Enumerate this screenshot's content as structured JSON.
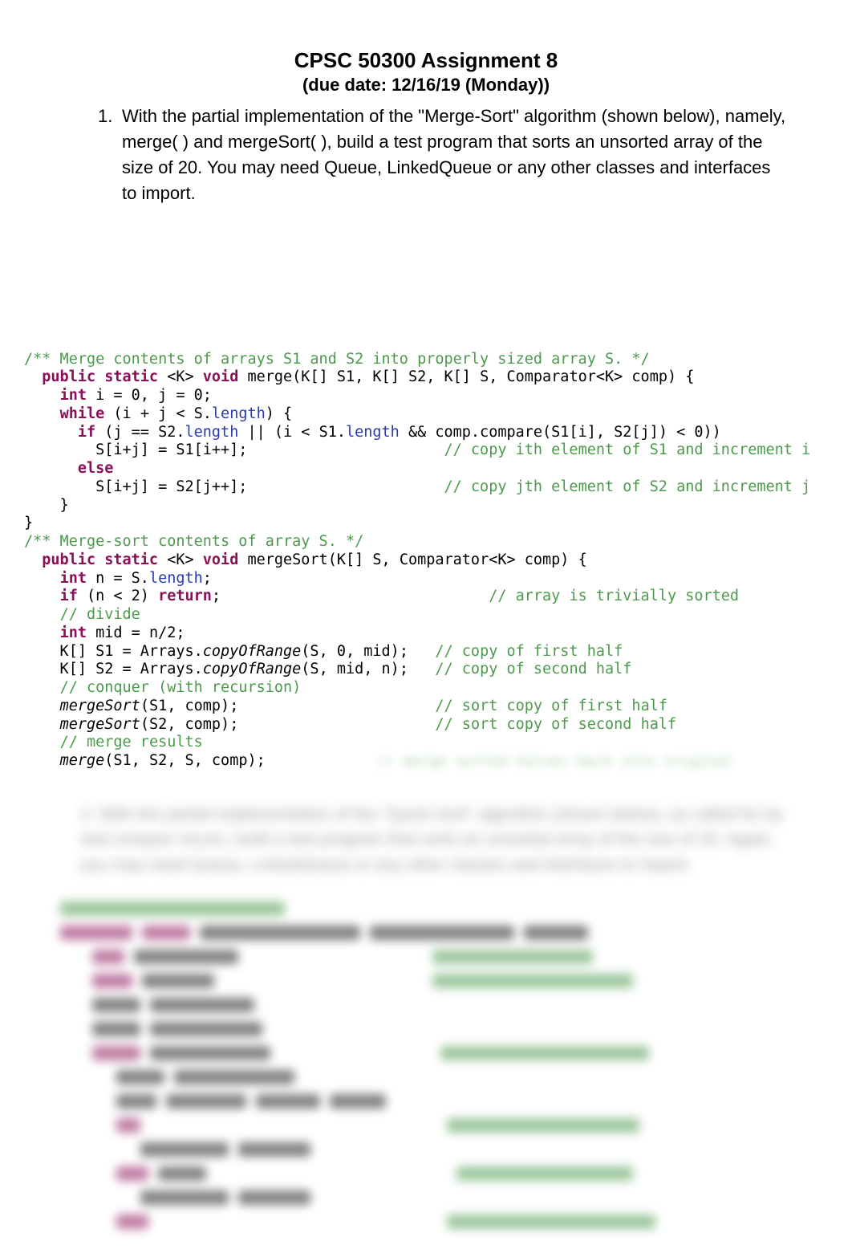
{
  "header": {
    "title": "CPSC 50300 Assignment 8",
    "subtitle": "(due date: 12/16/19 (Monday))"
  },
  "question1": {
    "number": "1.",
    "text": "With the partial implementation of the \"Merge-Sort\" algorithm (shown below), namely, merge( ) and mergeSort( ), build a test program that sorts an unsorted array of the size of 20. You may need Queue, LinkedQueue or any other classes and interfaces to import."
  },
  "code": {
    "c1": "/** Merge contents of arrays S1 and S2 into properly sized array S. */",
    "sig1a": "public static ",
    "sig1b": "<K> ",
    "sig1c": "void",
    "sig1d": " merge(K[] S1, K[] S2, K[] S, Comparator<K> comp) {",
    "l3a": "int",
    "l3b": " i = 0, j = 0;",
    "l4a": "while",
    "l4b": " (i + j < S.",
    "l4c": "length",
    "l4d": ") {",
    "l5a": "if",
    "l5b": " (j == S2.",
    "l5c": "length",
    "l5d": " || (i < S1.",
    "l5e": "length",
    "l5f": " && comp.compare(S1[i], S2[j]) < 0))",
    "l6a": "        S[i+j] = S1[i++];",
    "l6b": "// copy ith element of S1 and increment i",
    "l7a": "else",
    "l8a": "        S[i+j] = S2[j++];",
    "l8b": "// copy jth element of S2 and increment j",
    "l9a": "    }",
    "l10a": "}",
    "c2": "/** Merge-sort contents of array S. */",
    "sig2a": "public static ",
    "sig2b": "<K> ",
    "sig2c": "void",
    "sig2d": " mergeSort(K[] S, Comparator<K> comp) {",
    "l13a": "int",
    "l13b": " n = S.",
    "l13c": "length",
    "l13d": ";",
    "l14a": "if",
    "l14b": " (n < 2) ",
    "l14c": "return",
    "l14d": ";",
    "l14e": "// array is trivially sorted",
    "l15a": "// divide",
    "l16a": "int",
    "l16b": " mid = n/2;",
    "l17a": "    K[] S1 = Arrays.",
    "l17b": "copyOfRange",
    "l17c": "(S, 0, mid);",
    "l17d": "// copy of first half",
    "l18a": "    K[] S2 = Arrays.",
    "l18b": "copyOfRange",
    "l18c": "(S, mid, n);",
    "l18d": "// copy of second half",
    "l19a": "// conquer (with recursion)",
    "l20a": "mergeSort",
    "l20b": "(S1, comp);",
    "l20c": "// sort copy of first half",
    "l21a": "mergeSort",
    "l21b": "(S2, comp);",
    "l21c": "// sort copy of second half",
    "l22a": "// merge results",
    "l23a": "merge",
    "l23b": "(S1, S2, S, comp);"
  }
}
